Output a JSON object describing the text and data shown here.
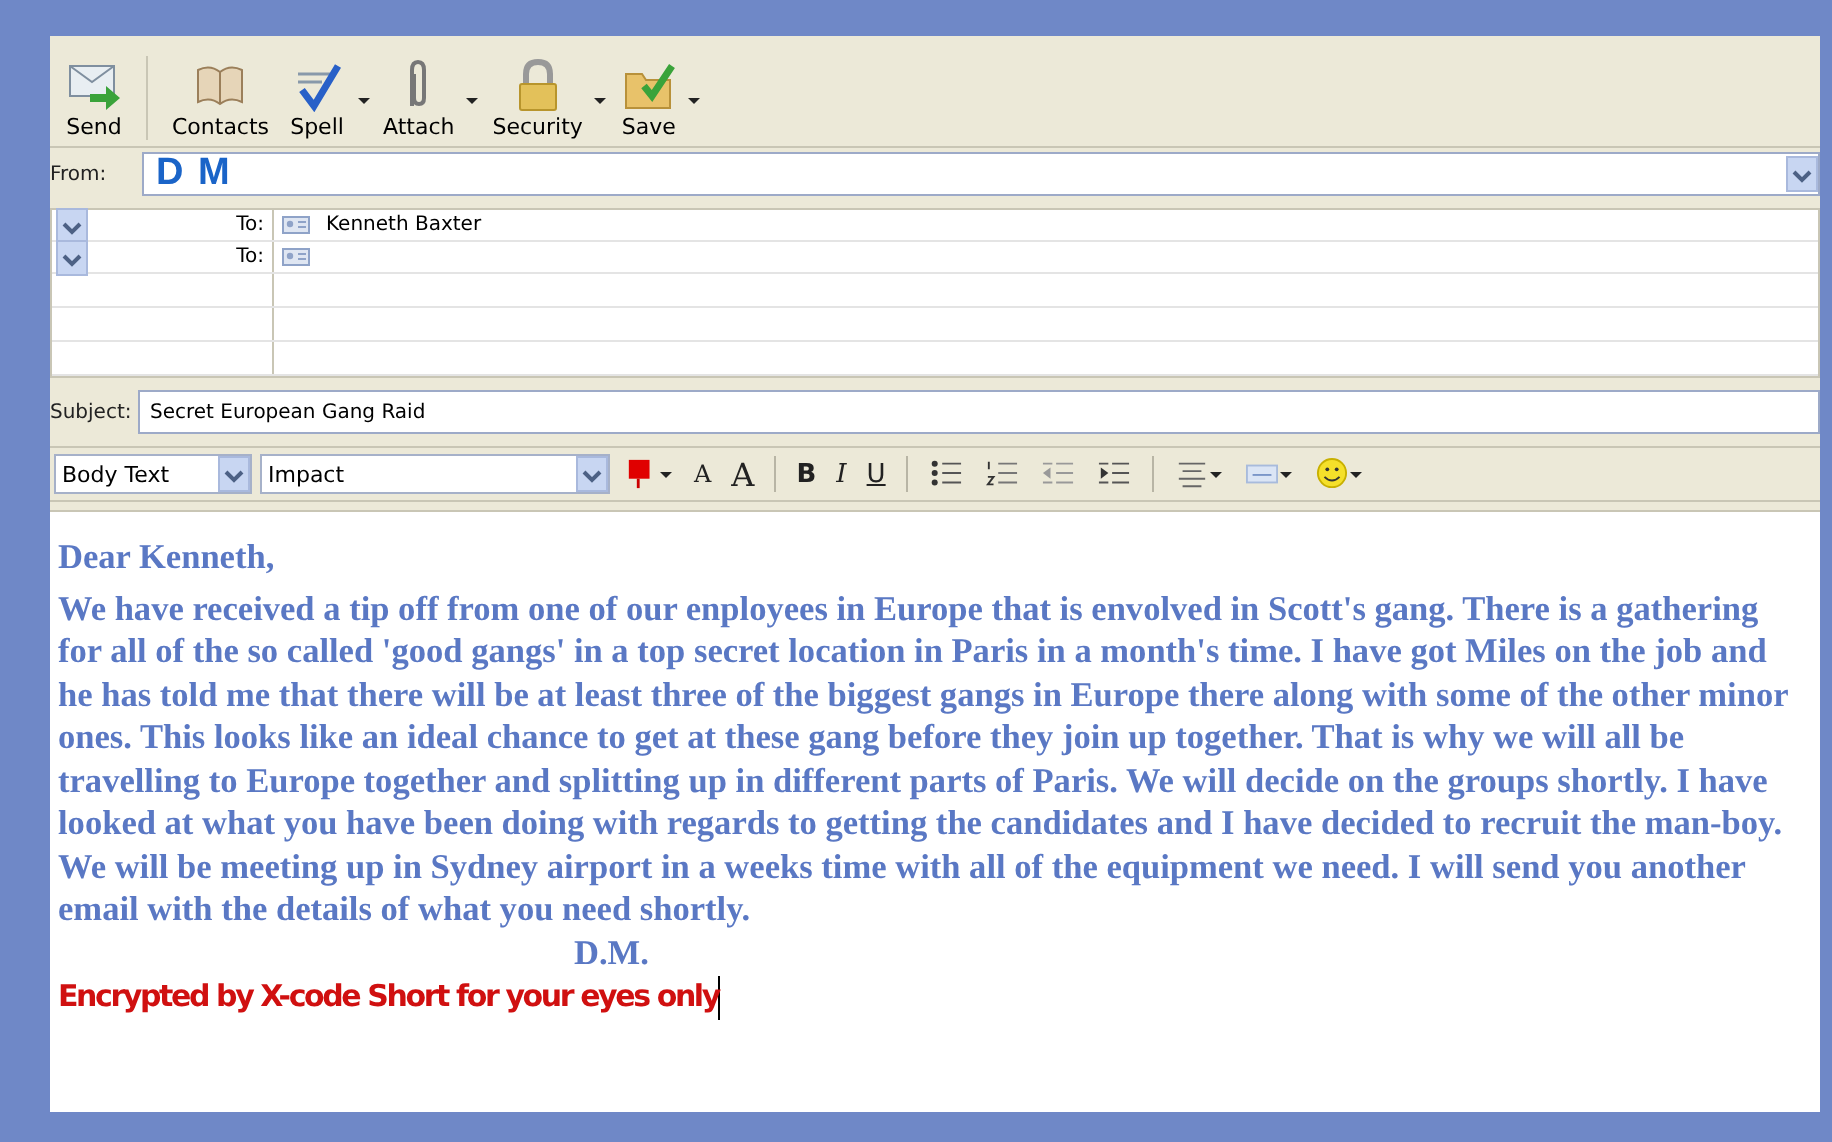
{
  "toolbar": {
    "buttons": [
      {
        "label": "Send",
        "has_menu": false
      },
      {
        "label": "Contacts",
        "has_menu": false
      },
      {
        "label": "Spell",
        "has_menu": true
      },
      {
        "label": "Attach",
        "has_menu": true
      },
      {
        "label": "Security",
        "has_menu": true
      },
      {
        "label": "Save",
        "has_menu": true
      }
    ]
  },
  "from": {
    "label": "From:",
    "value": "D M"
  },
  "recipients": [
    {
      "label": "To:",
      "value": "Kenneth Baxter"
    },
    {
      "label": "To:"
    }
  ],
  "subject": {
    "label": "Subject:",
    "value": "Secret European Gang Raid"
  },
  "format_bar": {
    "style": "Body Text",
    "font": "Impact",
    "tools": [
      {
        "kind": "color",
        "has_menu": true
      },
      {
        "kind": "smaller",
        "label": "A"
      },
      {
        "kind": "larger",
        "label": "A"
      },
      {
        "kind": "bold",
        "label": "B"
      },
      {
        "kind": "italic",
        "label": "I"
      },
      {
        "kind": "underline",
        "label": "U"
      },
      {
        "kind": "bullets"
      },
      {
        "kind": "numbers"
      },
      {
        "kind": "outdent"
      },
      {
        "kind": "indent"
      },
      {
        "kind": "align",
        "has_menu": true
      },
      {
        "kind": "rule",
        "has_menu": true
      },
      {
        "kind": "emoji",
        "has_menu": true
      }
    ]
  },
  "message": {
    "greeting": "Dear Kenneth,",
    "paragraph": "We have received a tip off from one of our enployees in Europe that is envolved in Scott's gang. There is a gathering for all of the so called 'good gangs' in a top secret location in Paris in a month's time. I have got Miles on the job and he has told me that there will be at least three of the biggest  gangs in Europe there along with some of the other minor  ones.  This looks like an ideal chance  to get at these gang before  they join up together.  That is why we will all be travelling to  Europe together and splitting up in different parts of Paris. We will decide on the groups shortly. I have looked at what you have been doing with regards to getting the candidates and I have decided to recruit the man-boy. We will be meeting up in Sydney airport in a weeks time with all of the equipment we need. I will send you another email with the details of what you need shortly.",
    "signature": "D.M.",
    "footer": "Encrypted by X-code Short for your eyes only"
  }
}
